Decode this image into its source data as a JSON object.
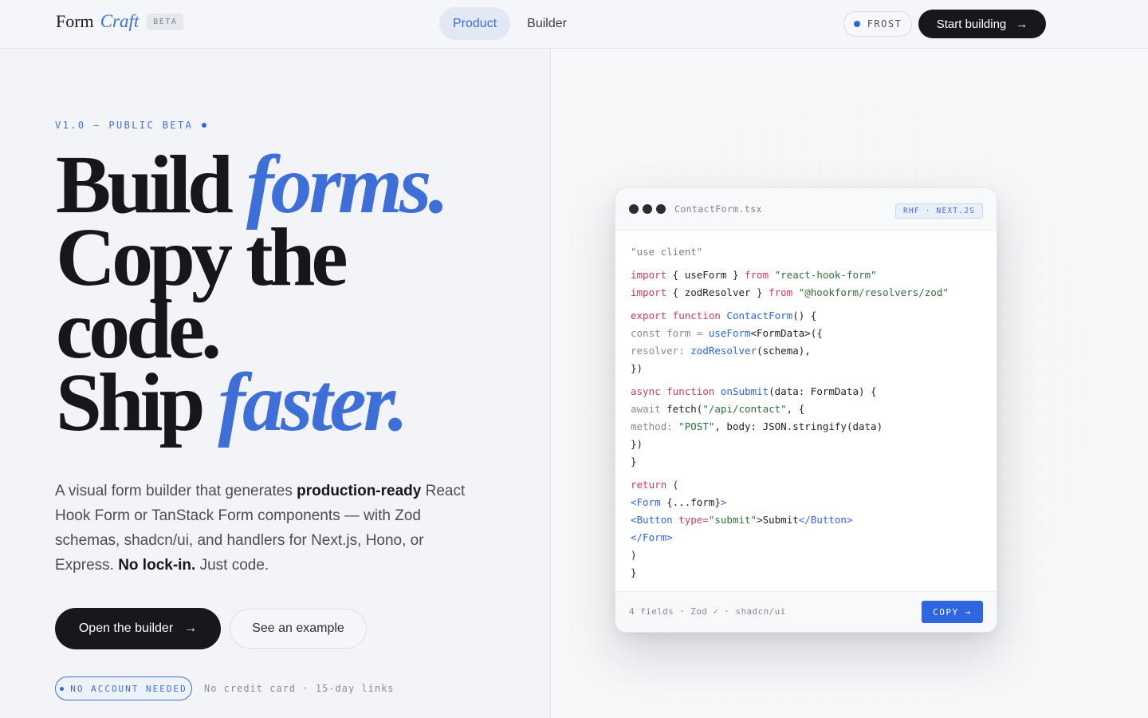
{
  "nav": {
    "brand_form": "Form",
    "brand_craft": "Craft",
    "beta_label": "BETA",
    "tabs": [
      {
        "label": "Product",
        "active": true
      },
      {
        "label": "Builder",
        "active": false
      }
    ],
    "theme_label": "FROST",
    "start_label": "Start building",
    "start_arrow": "→"
  },
  "hero": {
    "eyebrow": "V1.0 — PUBLIC BETA",
    "headline": {
      "line1_plain": "Build ",
      "line1_accent": "forms.",
      "line2": "Copy the",
      "line3": "code.",
      "line4_plain": "Ship ",
      "line4_accent": "faster."
    },
    "sub": {
      "p1": "A visual form builder that generates ",
      "b1": "production-ready",
      "p2": " React Hook Form or TanStack Form components — with Zod schemas, shadcn/ui, and handlers for Next.js, Hono, or Express. ",
      "b2": "No lock-in.",
      "p3": " Just code."
    },
    "primary_label": "Open the builder",
    "primary_arrow": "→",
    "secondary_label": "See an example",
    "pill_label": "NO ACCOUNT NEEDED",
    "note": "No credit card · 15-day links"
  },
  "code_card": {
    "filename": "ContactForm.tsx",
    "badge": "RHF · NEXT.JS",
    "lines": [
      {
        "c": "\"use client\""
      },
      {
        "k1": "import",
        "t1": " { useForm } ",
        "k2": "from",
        "s": " \"react-hook-form\""
      },
      {
        "k1": "import",
        "t1": " { zodResolver } ",
        "k2": "from",
        "s": " \"@hookform/resolvers/zod\""
      },
      {
        "k1": "export",
        "k2": " function ",
        "f": "ContactForm",
        "t": "() {"
      },
      {
        "d": "const form = ",
        "f": "useForm",
        "t": "<FormData>({"
      },
      {
        "d": "resolver: ",
        "f": "zodResolver",
        "t": "(schema),"
      },
      {
        "t": "})"
      },
      {
        "k1": "async",
        "k2": " function ",
        "f": "onSubmit",
        "t": "(data: FormData) {"
      },
      {
        "d": "await ",
        "t1": "fetch(",
        "s": "\"/api/contact\"",
        "t": ", {"
      },
      {
        "d": "method: ",
        "s": "\"POST\"",
        "t": ", body: JSON.stringify(data)"
      },
      {
        "t": "})"
      },
      {
        "t": "}"
      },
      {
        "k1": "return",
        "t": " ("
      },
      {
        "g1": "<Form",
        "t1": " {...form}",
        "g2": ">"
      },
      {
        "g1": "<Button",
        "k2": " type=",
        "s": "\"submit\"",
        "t1": ">Submit",
        "g2": "</Button>"
      },
      {
        "g1": "</Form>"
      },
      {
        "t": ")"
      },
      {
        "t": "}"
      }
    ],
    "footer_meta": "4 fields · Zod ✓ · shadcn/ui",
    "copy_label": "COPY →"
  }
}
